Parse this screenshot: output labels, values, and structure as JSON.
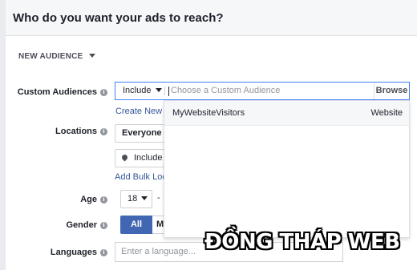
{
  "header": {
    "title": "Who do you want your ads to reach?"
  },
  "audience": {
    "label": "NEW AUDIENCE"
  },
  "custom_audiences": {
    "label": "Custom Audiences",
    "include": "Include",
    "placeholder": "Choose a Custom Audience",
    "browse": "Browse",
    "create_link": "Create New C",
    "dropdown": [
      {
        "name": "MyWebsiteVisitors",
        "type": "Website"
      }
    ]
  },
  "locations": {
    "label": "Locations",
    "scope": "Everyone in",
    "include": "Include",
    "bulk_link": "Add Bulk Loca"
  },
  "age": {
    "label": "Age",
    "min": "18",
    "separator": "-"
  },
  "gender": {
    "label": "Gender",
    "all": "All",
    "men_partial": "M"
  },
  "languages": {
    "label": "Languages",
    "placeholder": "Enter a language..."
  },
  "watermark": "ĐỒNG THÁP WEB"
}
